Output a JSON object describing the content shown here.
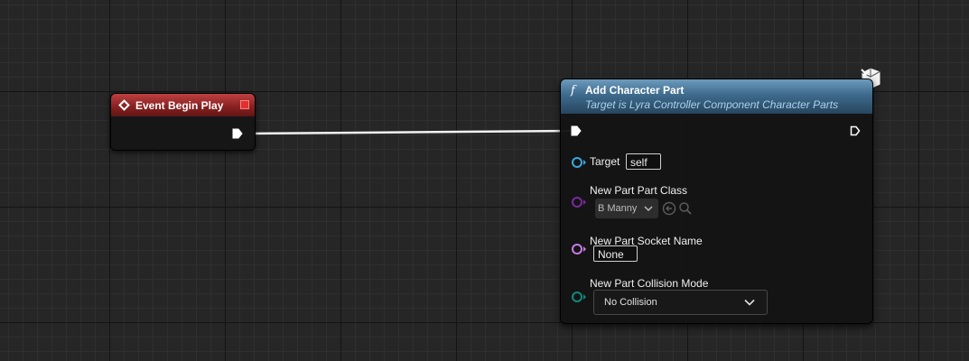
{
  "event_node": {
    "title": "Event Begin Play",
    "header_color": "#8a2222"
  },
  "function_node": {
    "title": "Add Character Part",
    "subtitle": "Target is Lyra Controller Component Character Parts",
    "header_color": "#3e6a8c",
    "pins": {
      "target": {
        "label": "Target",
        "value": "self",
        "color": "#38a9e0"
      },
      "part_class": {
        "label": "New Part Part Class",
        "value": "B Manny",
        "color": "#7a2aa0"
      },
      "socket_name": {
        "label": "New Part Socket Name",
        "value": "None",
        "color": "#c77de6"
      },
      "collision_mode": {
        "label": "New Part Collision Mode",
        "value": "No Collision",
        "color": "#0f8a80"
      }
    }
  },
  "icons": {
    "function": "function-f-icon",
    "server_only": "lightning-cube-icon",
    "use_selected": "arrow-left-circle-icon",
    "browse": "magnifier-icon"
  }
}
